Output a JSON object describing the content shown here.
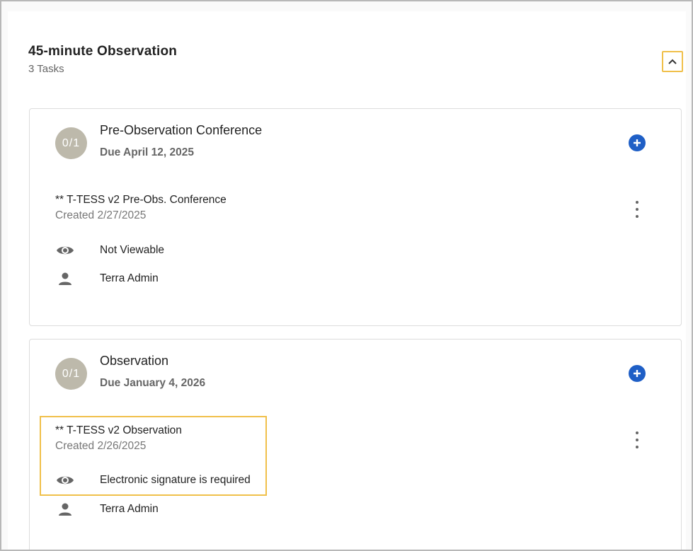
{
  "section": {
    "title": "45-minute Observation",
    "subtitle": "3 Tasks",
    "collapse_icon": "chevron-up-icon"
  },
  "tasks": [
    {
      "progress": "0/1",
      "title": "Pre-Observation Conference",
      "due": "Due April 12, 2025",
      "item": {
        "name": "** T-TESS v2 Pre-Obs. Conference",
        "created": "Created 2/27/2025",
        "visibility": "Not Viewable",
        "owner": "Terra Admin"
      }
    },
    {
      "progress": "0/1",
      "title": "Observation",
      "due": "Due January 4, 2026",
      "item": {
        "name": "** T-TESS v2 Observation",
        "created": "Created 2/26/2025",
        "visibility": "Electronic signature is required",
        "owner": "Terra Admin"
      }
    }
  ],
  "colors": {
    "accent_blue": "#1f5fc6",
    "highlight": "#f0c04a",
    "badge_bg": "#bdb9ab"
  }
}
